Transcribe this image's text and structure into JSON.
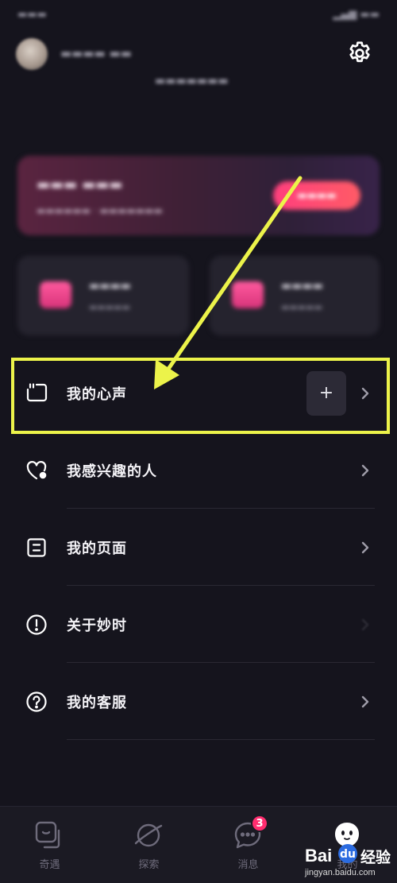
{
  "menu": {
    "items": [
      {
        "label": "我的心声",
        "has_plus": true,
        "plus_label": "+"
      },
      {
        "label": "我感兴趣的人"
      },
      {
        "label": "我的页面"
      },
      {
        "label": "关于妙时"
      },
      {
        "label": "我的客服"
      }
    ]
  },
  "tab_bar": {
    "tabs": [
      {
        "label": "奇遇",
        "icon": "encounter-icon"
      },
      {
        "label": "探索",
        "icon": "planet-icon"
      },
      {
        "label": "消息",
        "icon": "message-icon",
        "badge": "3"
      },
      {
        "label": "我的",
        "icon": "profile-icon"
      }
    ]
  },
  "watermark": {
    "brand": "Bai",
    "brand_suffix": "经验",
    "url": "jingyan.baidu.com"
  },
  "colors": {
    "background": "#15141d",
    "highlight": "#ecf34a",
    "badge": "#ff2d6f",
    "tab_bar": "#1b1a23"
  }
}
